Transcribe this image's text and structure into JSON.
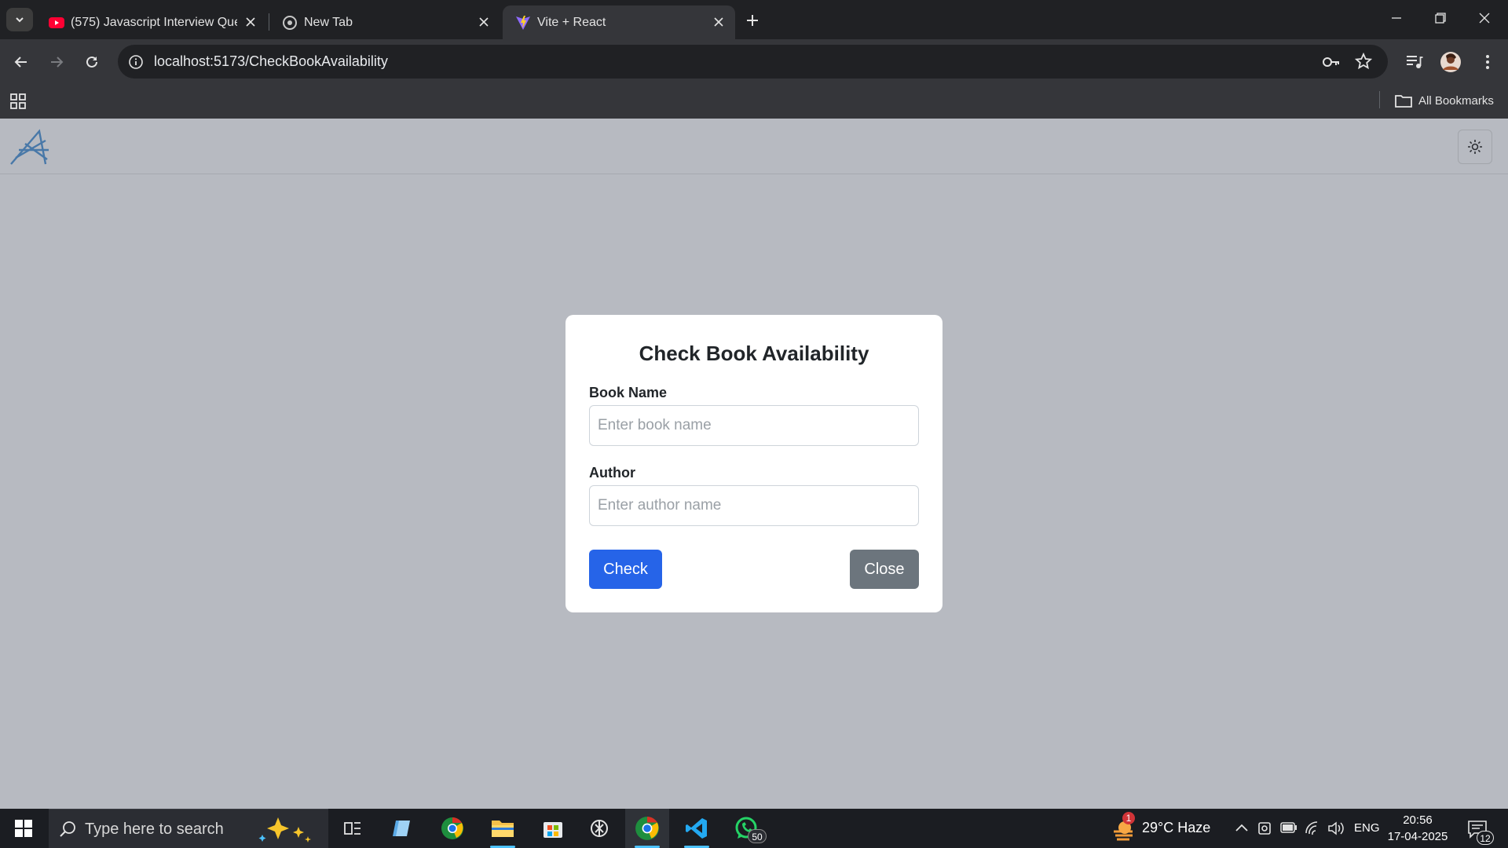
{
  "browser": {
    "tabs": [
      {
        "title": "(575) Javascript Interview Questions",
        "favicon": "youtube-icon",
        "active": false
      },
      {
        "title": "New Tab",
        "favicon": "chrome-icon",
        "active": false
      },
      {
        "title": "Vite + React",
        "favicon": "vite-icon",
        "active": true
      }
    ],
    "url": "localhost:5173/CheckBookAvailability",
    "bookmarks_label": "All Bookmarks"
  },
  "app": {
    "logo": "app-logo",
    "theme_toggle_icon": "sun-icon"
  },
  "modal": {
    "title": "Check Book Availability",
    "book_label": "Book Name",
    "book_placeholder": "Enter book name",
    "author_label": "Author",
    "author_placeholder": "Enter author name",
    "check_label": "Check",
    "close_label": "Close"
  },
  "taskbar": {
    "search_placeholder": "Type here to search",
    "weather": "29°C  Haze",
    "weather_badge": "1",
    "whatsapp_badge": "50",
    "language": "ENG",
    "time": "20:56",
    "date": "17-04-2025",
    "notifications": "12"
  },
  "colors": {
    "primary": "#2664e8",
    "secondary": "#6c757d",
    "backdrop": "#b7bac1"
  }
}
